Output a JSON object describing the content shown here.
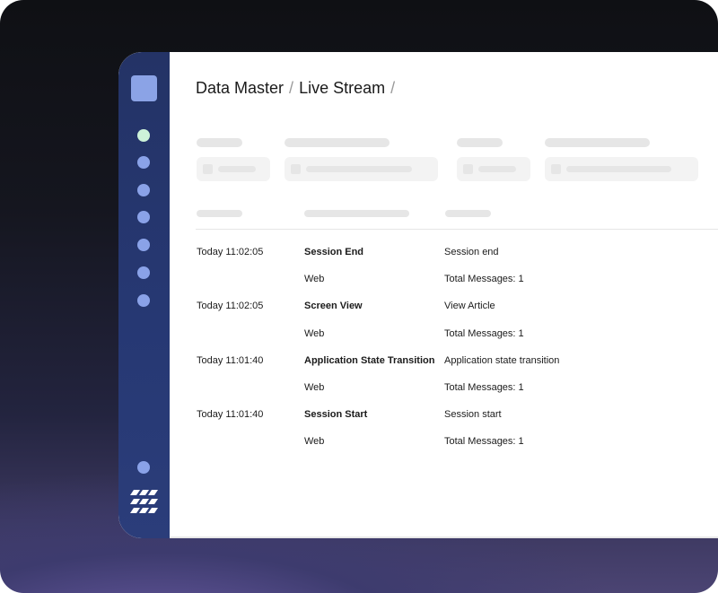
{
  "breadcrumb": {
    "items": [
      "Data Master",
      "Live Stream"
    ],
    "separator": "/"
  },
  "events": [
    {
      "time": "Today 11:02:05",
      "name": "Session End",
      "description": "Session end",
      "source": "Web",
      "messages_label": "Total Messages:",
      "messages": "1"
    },
    {
      "time": "Today 11:02:05",
      "name": "Screen View",
      "description": "View Article",
      "source": "Web",
      "messages_label": "Total Messages:",
      "messages": "1"
    },
    {
      "time": "Today 11:01:40",
      "name": "Application State Transition",
      "description": "Application state transition",
      "source": "Web",
      "messages_label": "Total Messages:",
      "messages": "1"
    },
    {
      "time": "Today 11:01:40",
      "name": "Session Start",
      "description": "Session start",
      "source": "Web",
      "messages_label": "Total Messages:",
      "messages": "1"
    }
  ],
  "sidebar": {
    "nav_icons": [
      "status-dot",
      "nav-dot",
      "nav-dot",
      "nav-dot",
      "nav-dot",
      "nav-dot",
      "nav-dot"
    ],
    "bottom_icons": [
      "profile-dot",
      "brand-logo"
    ]
  },
  "colors": {
    "sidebar": "#263873",
    "accent": "#8aa2e8",
    "active_dot": "#cdf2d9"
  }
}
